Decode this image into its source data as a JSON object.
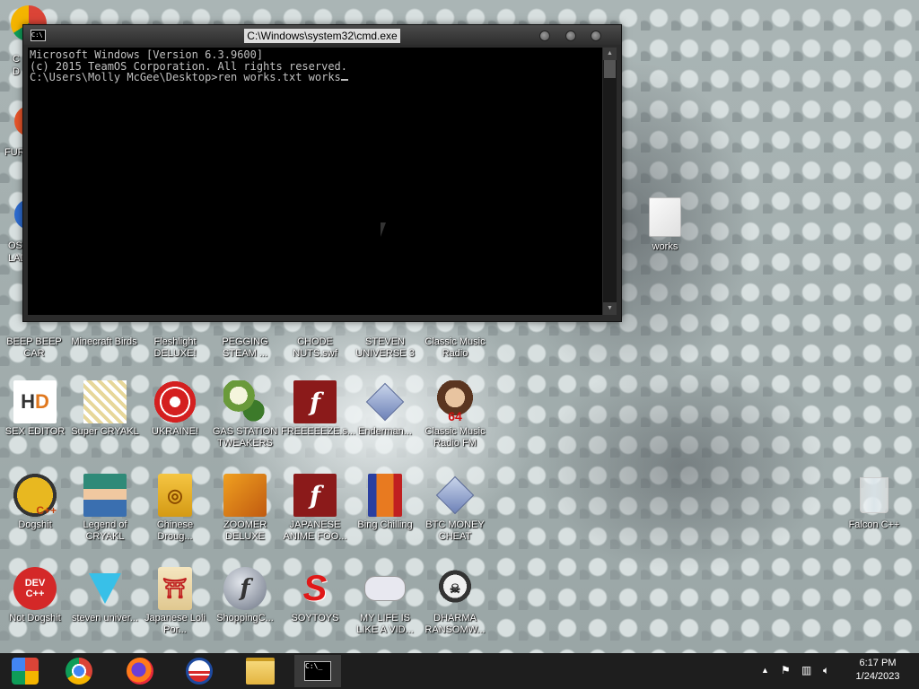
{
  "cmd_window": {
    "title": "C:\\Windows\\system32\\cmd.exe",
    "lines": [
      "Microsoft Windows [Version 6.3.9600]",
      "(c) 2015 TeamOS Corporation. All rights reserved.",
      "",
      "C:\\Users\\Molly McGee\\Desktop>ren works.txt works"
    ]
  },
  "desktop": {
    "partial_labels": {
      "left1": "C",
      "left1b": "D",
      "left2": "FUR",
      "left3": "OS",
      "left3b": "LAD"
    },
    "row1": [
      "BEEP BEEP CAR",
      "Minecraft Birds",
      "Fleshlight DELUXE!",
      "PEGGING STEAM ...",
      "CHODE NUTS.swf",
      "STEVEN UNIVERSE 3",
      "Classic Music Radio"
    ],
    "row2": [
      "SEX EDITOR",
      "Super CRYAKL",
      "UKRAINE!",
      "GAS STATION TWEAKERS",
      "FREEEEEZE.s...",
      "Enderman...",
      "Classic Music Radio FM"
    ],
    "row3": [
      "Dogshit",
      "Legend of CRYAKL",
      "Chinese Droug...",
      "ZOOMER DELUXE",
      "JAPANESE ANIME FOO...",
      "Bing Chilling",
      "BTC MONEY CHEAT"
    ],
    "row4": [
      "Not Dogshit",
      "steven univer...",
      "Japanese Loli Por...",
      "ShoppingC...",
      "SOYTOYS",
      "MY LIFE IS LIKE A VID...",
      "DHARMA RANSOMW..."
    ],
    "works_label": "works",
    "falcon_label": "Falcon C++"
  },
  "taskbar": {
    "apps": [
      "start-orb",
      "chrome",
      "firefox",
      "obama",
      "file-explorer",
      "cmd"
    ],
    "time": "6:17 PM",
    "date": "1/24/2023"
  }
}
